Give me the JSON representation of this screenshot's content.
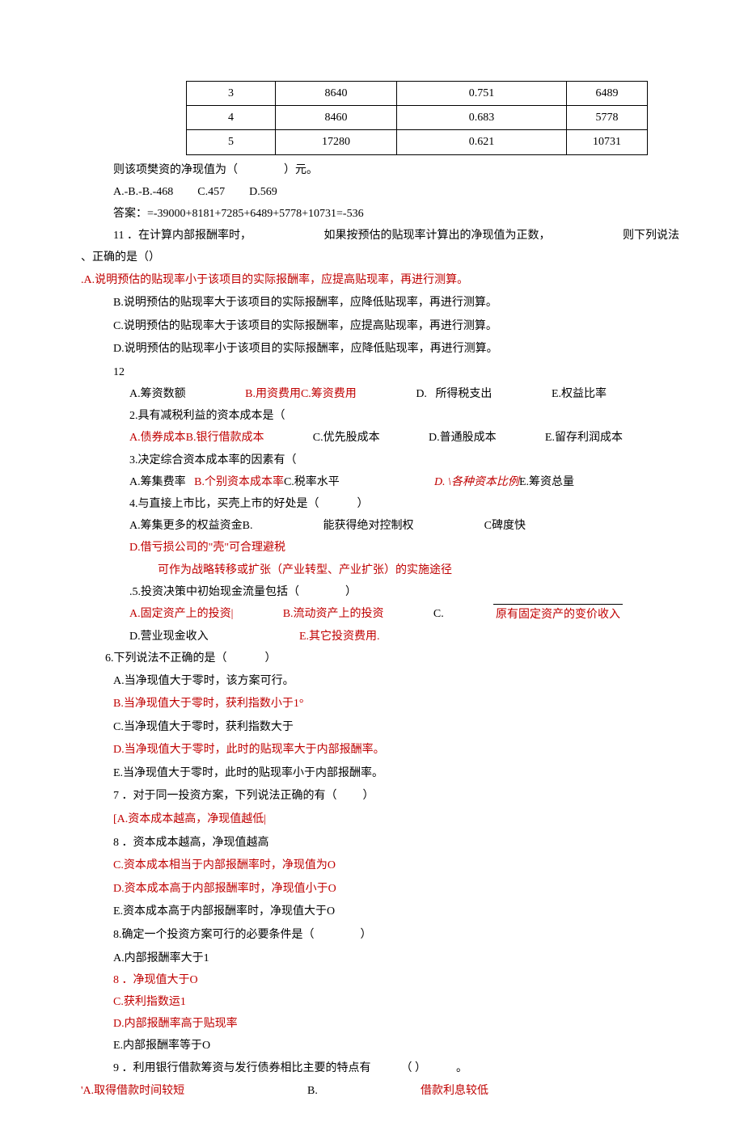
{
  "table": {
    "rows": [
      {
        "c1": "3",
        "c2": "8640",
        "c3": "0.751",
        "c4": "6489"
      },
      {
        "c1": "4",
        "c2": "8460",
        "c3": "0.683",
        "c4": "5778"
      },
      {
        "c1": "5",
        "c2": "17280",
        "c3": "0.621",
        "c4": "10731"
      }
    ]
  },
  "pre": {
    "stem": "则该项樊资的净现值为（",
    "stem2": "）元。",
    "opts": "A.-B.-B.-468",
    "optC": "C.457",
    "optD": "D.569",
    "ans": "答案：=-39000+8181+7285+6489+5778+10731=-536"
  },
  "q11": {
    "stem1": "11 ．在计算内部报酬率时，",
    "stem2": "如果按预估的贴现率计算出的净现值为正数，",
    "stem3": "则下列说法",
    "stem4": "、正确的是（）",
    "A": ".A.说明预估的贴现率小于该项目的实际报酬率，应提高贴现率，再进行测算。",
    "B": "B.说明预估的贴现率大于该项目的实际报酬率，应降低贴现率，再进行测算。",
    "C": "C.说明预估的贴现率大于该项目的实际报酬率，应提高贴现率，再进行测算。",
    "D": "D.说明预估的贴现率小于该项目的实际报酬率，应降低贴现率，再进行测算。"
  },
  "q12hdr": "12",
  "q1": {
    "A": "A.筹资数额",
    "B": "B.用资费用",
    "C": "C.筹资费用",
    "D": "D.",
    "Dt": "所得税支出",
    "E": "E.权益比率"
  },
  "q2": {
    "stem": "2.具有减税利益的资本成本是（",
    "A": "A.债券成本",
    "B": "B.银行借款成本",
    "C": "C.优先股成本",
    "D": "D.普通股成本",
    "E": "E.留存利润成本"
  },
  "q3": {
    "stem": "3.决定综合资本成本率的因素有（",
    "A": "A.筹集费率",
    "B": "B.个别资本成本率",
    "C": "C.税率水平",
    "D": "D. \\各种资本比例",
    "E": "E.筹资总量"
  },
  "q4": {
    "stem": "4.与直接上市比，买壳上市的好处是（",
    "stem2": "）",
    "A": "A.筹集更多的权益资金B.",
    "Bt": "能获得绝对控制权",
    "C": "C碑度快",
    "D": "D.借亏损公司的\"壳\"可合理避税",
    "E": "可作为战略转移或扩张（产业转型、产业扩张）的实施途径"
  },
  "q5": {
    "stem": ".5.投资决策中初始现金流量包括（",
    "stem2": "）",
    "A": "A.固定资产上的投资|",
    "B": "B.流动资产上的投资",
    "C": "C.",
    "Ct": "原有固定资产的变价收入",
    "D": "D.营业现金收入",
    "E": "E.其它投资费用."
  },
  "q6": {
    "stem": "6.下列说法不正确的是（",
    "stem2": "）",
    "A": "A.当净现值大于零时，该方案可行。",
    "B": "B.当净现值大于零时，获利指数小于1°",
    "C": "C.当净现值大于零时，获利指数大于",
    "D": "D.当净现值大于零时，此时的贴现率大于内部报酬率。",
    "E": "E.当净现值大于零时，此时的贴现率小于内部报酬率。"
  },
  "q7": {
    "stem": "7 ．对于同一投资方案，下列说法正确的有（",
    "stem2": "）",
    "A": "[A.资本成本越高，净现值越低|",
    "B": "8 ．资本成本越高，净现值越高",
    "C": "C.资本成本相当于内部报酬率时，净现值为O",
    "D": "D.资本成本高于内部报酬率时，净现值小于O",
    "E": "E.资本成本高于内部报酬率时，净现值大于O"
  },
  "q8": {
    "stem": "8.确定一个投资方案可行的必要条件是（",
    "stem2": "）",
    "A": "A.内部报酬率大于1",
    "B": "8 ．净现值大于O",
    "C": "C.获利指数运1",
    "D": "D.内部报酬率高于贴现率",
    "E": "E.内部报酬率等于O"
  },
  "q9": {
    "stem": "9 ．利用银行借款筹资与发行债券相比主要的特点有",
    "paren": "（      ）",
    "dot": "。",
    "A": "'A.取得借款时间较短",
    "B": "B.",
    "Bt": "借款利息较低"
  }
}
